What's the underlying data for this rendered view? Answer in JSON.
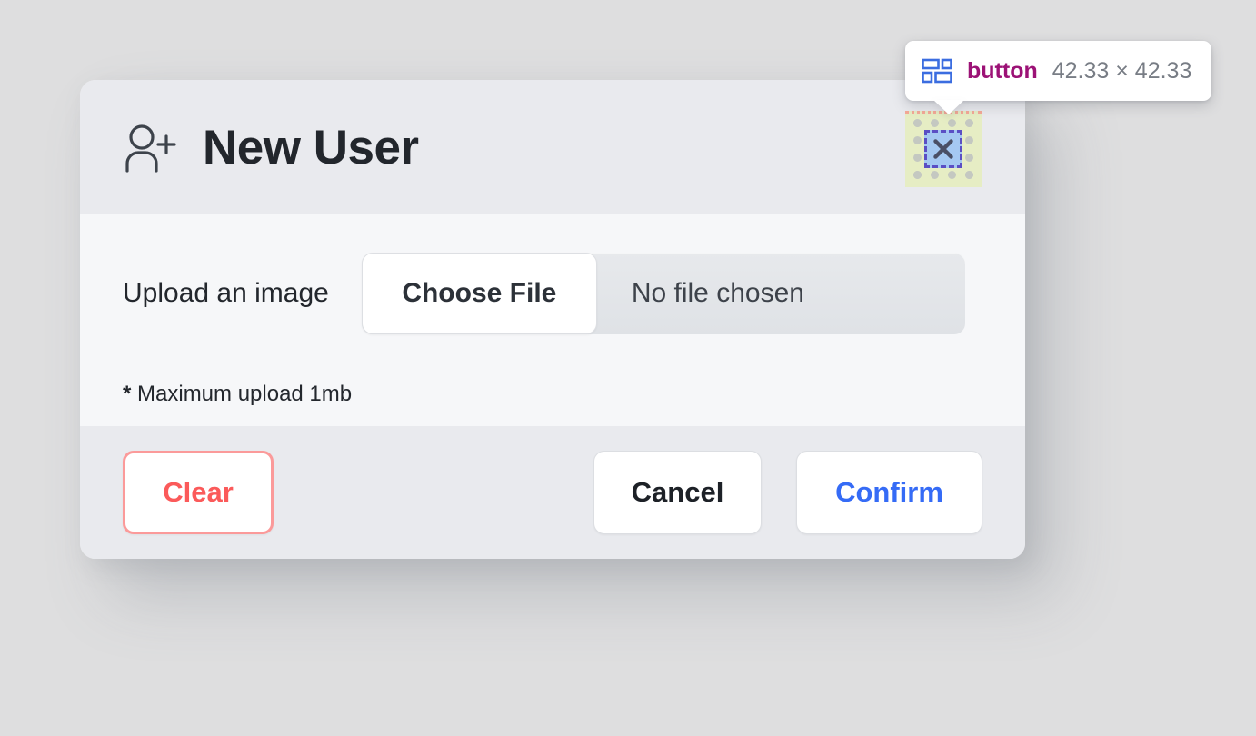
{
  "page": {
    "background_color": "#dededf"
  },
  "dialog": {
    "header": {
      "icon": "user-plus-icon",
      "title": "New User",
      "close_label": "×",
      "close_icon": "close-x-icon",
      "background_color": "#e9eaee",
      "title_color": "#22262c"
    },
    "body": {
      "upload_label": "Upload an image",
      "choose_file_label": "Choose File",
      "file_status": "No file chosen",
      "hint_asterisk": "*",
      "hint_text": "Maximum upload 1mb",
      "background_color": "#f6f7f9"
    },
    "footer": {
      "clear_label": "Clear",
      "cancel_label": "Cancel",
      "confirm_label": "Confirm",
      "clear_color": "#fb5a5a",
      "clear_border_color": "#fb9a9a",
      "cancel_color": "#1d2127",
      "confirm_color": "#356bf6",
      "background_color": "#e9eaee"
    }
  },
  "inspector": {
    "tooltip": {
      "icon": "layout-blocks-icon",
      "tag": "button",
      "size": "42.33 × 42.33",
      "tag_color": "#9c1276",
      "size_color": "#787d85"
    },
    "highlight": {
      "padding_color": "#e6edc4",
      "border_color": "#b9bcc0",
      "content_color": "#a5c8f2",
      "content_outline_color": "#5b4fc4",
      "margin_color": "#f4a896",
      "target": "close-button"
    }
  }
}
